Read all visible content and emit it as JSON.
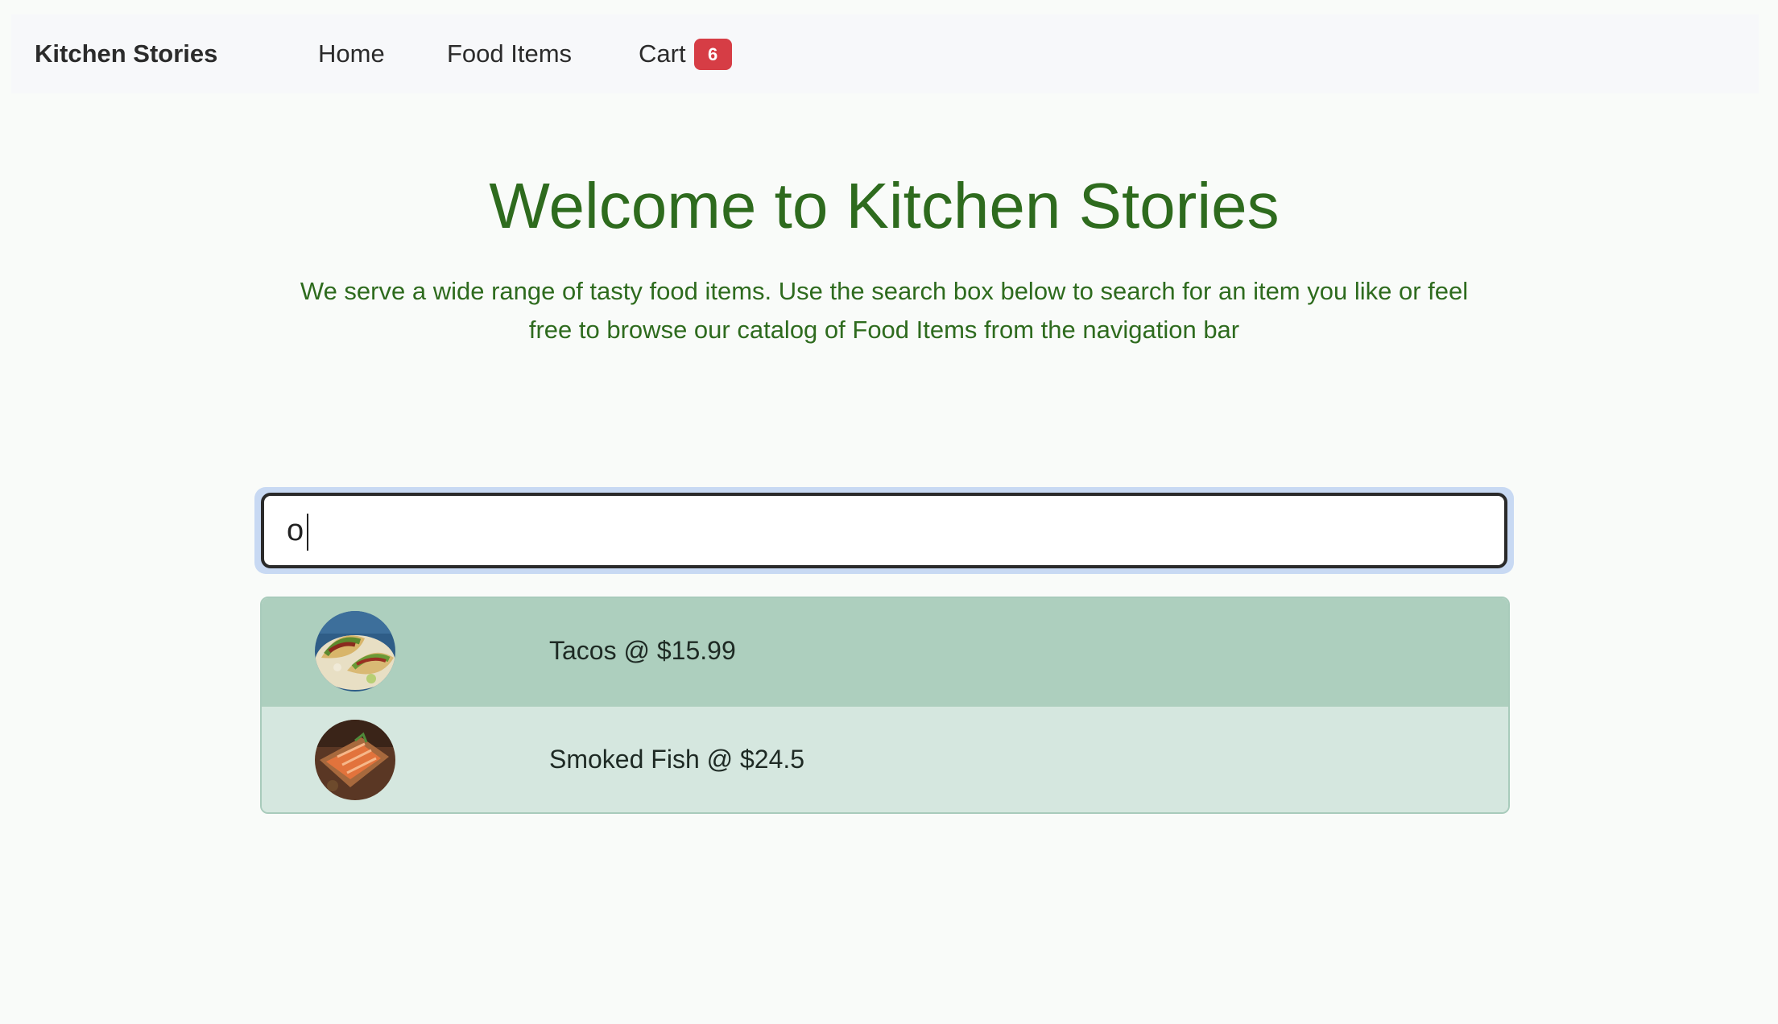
{
  "navbar": {
    "brand": "Kitchen Stories",
    "links": [
      {
        "label": "Home"
      },
      {
        "label": "Food Items"
      },
      {
        "label": "Cart",
        "badge": "6"
      }
    ]
  },
  "hero": {
    "title": "Welcome to Kitchen Stories",
    "description": "We serve a wide range of tasty food items. Use the search box below to search for an item you like or feel free to browse our catalog of Food Items from the navigation bar"
  },
  "search": {
    "value": "o"
  },
  "results": [
    {
      "label": "Tacos @ $15.99",
      "image_icon": "tacos-thumbnail",
      "active": true
    },
    {
      "label": "Smoked Fish @ $24.5",
      "image_icon": "smoked-fish-thumbnail",
      "active": false
    }
  ],
  "colors": {
    "accent_green": "#2e6b1e",
    "badge_red": "#d63d45",
    "result_active": "#adcfbe",
    "result_normal": "#d5e7df"
  }
}
